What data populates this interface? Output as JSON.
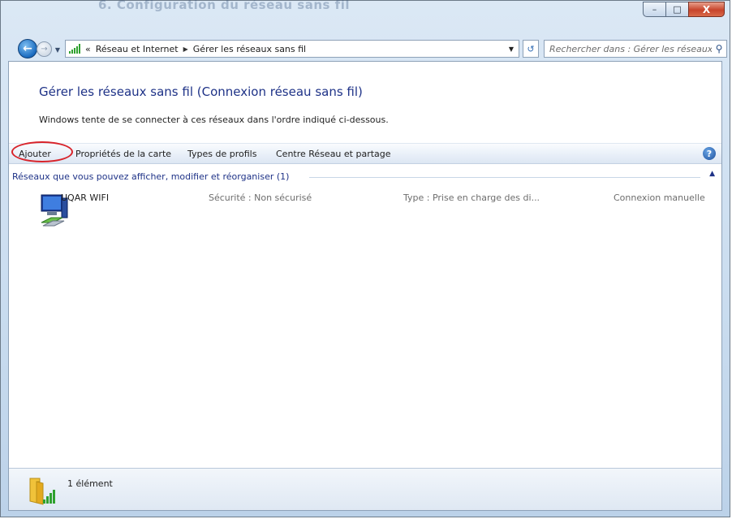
{
  "window": {
    "caption_buttons": {
      "minimize": "–",
      "maximize": "□",
      "close": "X"
    },
    "background_title": "6. Configuration du réseau sans fil"
  },
  "address_bar": {
    "overflow": "«",
    "breadcrumbs": [
      "Réseau et Internet",
      "Gérer les réseaux sans fil"
    ],
    "search_placeholder": "Rechercher dans : Gérer les réseaux sa..."
  },
  "page": {
    "title": "Gérer les réseaux sans fil (Connexion réseau sans fil)",
    "subtitle": "Windows tente de se connecter à ces réseaux dans l'ordre indiqué ci-dessous."
  },
  "toolbar": {
    "items": [
      "Ajouter",
      "Propriétés de la carte",
      "Types de profils",
      "Centre Réseau et partage"
    ],
    "help": "?"
  },
  "group": {
    "label": "Réseaux que vous pouvez afficher, modifier et réorganiser (1)"
  },
  "networks": [
    {
      "name": "UQAR WIFI",
      "security": "Sécurité : Non sécurisé",
      "type": "Type : Prise en charge des di...",
      "mode": "Connexion manuelle"
    }
  ],
  "status_bar": {
    "count_text": "1 élément"
  },
  "colors": {
    "title_blue": "#1e3287",
    "highlight_ring": "#d8232a",
    "link_blue": "#1e3287"
  }
}
